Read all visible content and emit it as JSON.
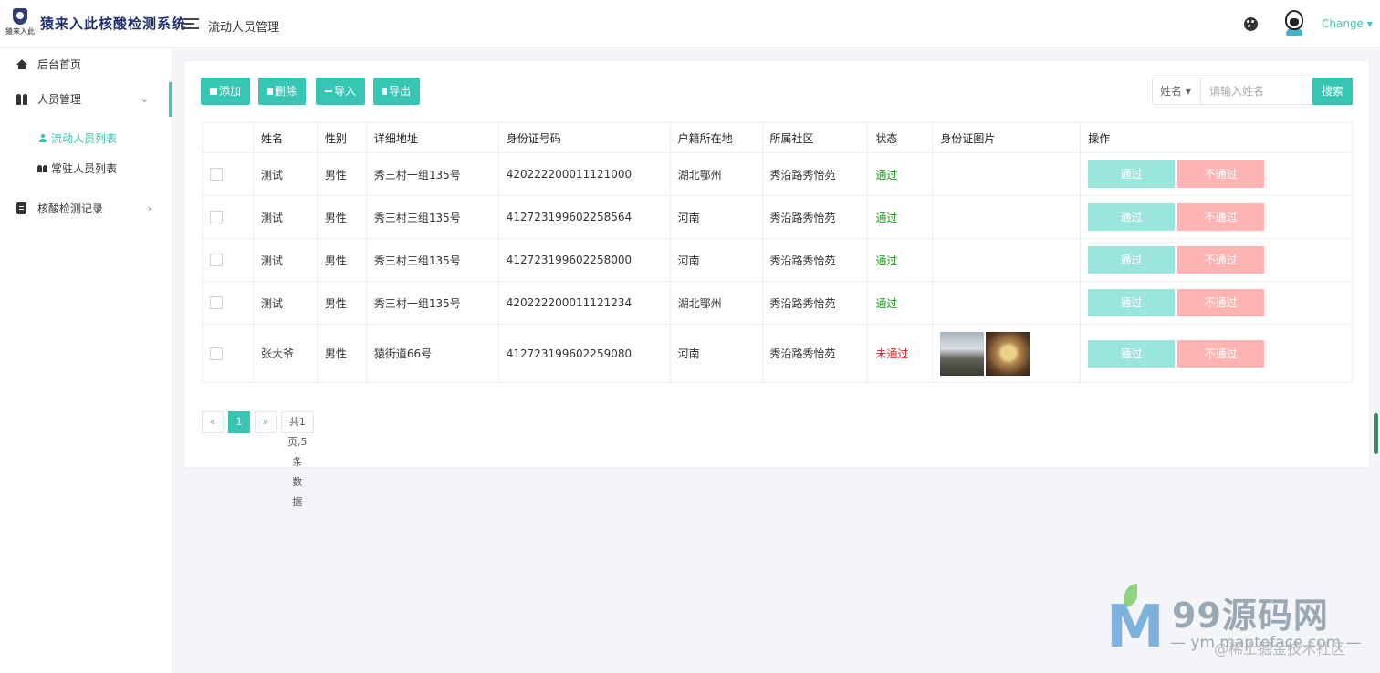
{
  "header": {
    "logo_text": "猿来入此",
    "app_title": "猿来入此核酸检测系统",
    "page_heading": "流动人员管理",
    "user_menu": "Change ▾"
  },
  "sidebar": {
    "items": [
      {
        "label": "后台首页",
        "icon": "home-icon"
      },
      {
        "label": "人员管理",
        "icon": "people-icon",
        "expanded": true
      },
      {
        "label": "核酸检测记录",
        "icon": "clipboard-icon"
      }
    ],
    "sub_items": [
      {
        "label": "流动人员列表",
        "active": true
      },
      {
        "label": "常驻人员列表",
        "active": false
      }
    ]
  },
  "toolbar": {
    "add": "添加",
    "delete": "删除",
    "import": "导入",
    "export": "导出",
    "search_field": "姓名 ▾",
    "search_placeholder": "请输入姓名",
    "search_button": "搜索"
  },
  "table": {
    "columns": [
      "姓名",
      "性别",
      "详细地址",
      "身份证号码",
      "户籍所在地",
      "所属社区",
      "状态",
      "身份证图片",
      "操作"
    ],
    "rows": [
      {
        "name": "测试",
        "gender": "男性",
        "address": "秀三村一组135号",
        "id_number": "420222200011121000",
        "hometown": "湖北鄂州",
        "community": "秀沿路秀怡苑",
        "status": "通过",
        "status_ok": true,
        "images": 0
      },
      {
        "name": "测试",
        "gender": "男性",
        "address": "秀三村三组135号",
        "id_number": "412723199602258564",
        "hometown": "河南",
        "community": "秀沿路秀怡苑",
        "status": "通过",
        "status_ok": true,
        "images": 0
      },
      {
        "name": "测试",
        "gender": "男性",
        "address": "秀三村三组135号",
        "id_number": "412723199602258000",
        "hometown": "河南",
        "community": "秀沿路秀怡苑",
        "status": "通过",
        "status_ok": true,
        "images": 0
      },
      {
        "name": "测试",
        "gender": "男性",
        "address": "秀三村一组135号",
        "id_number": "420222200011121234",
        "hometown": "湖北鄂州",
        "community": "秀沿路秀怡苑",
        "status": "通过",
        "status_ok": true,
        "images": 0
      },
      {
        "name": "张大爷",
        "gender": "男性",
        "address": "猿街道66号",
        "id_number": "412723199602259080",
        "hometown": "河南",
        "community": "秀沿路秀怡苑",
        "status": "未通过",
        "status_ok": false,
        "images": 2
      }
    ],
    "action_pass": "通过",
    "action_fail": "不通过"
  },
  "pagination": {
    "prev": "«",
    "current": "1",
    "next": "»",
    "info": "共1页,5条数据"
  },
  "watermark": {
    "title": "99源码网",
    "subtitle": "— ym.maptoface.com —",
    "credit": "@稀土掘金技术社区"
  },
  "colors": {
    "accent": "#36c6b3",
    "pass_button": "#9be6dc",
    "fail_button": "#ffb3b3",
    "status_ok": "#1a9a1a",
    "status_fail": "#e02020"
  }
}
